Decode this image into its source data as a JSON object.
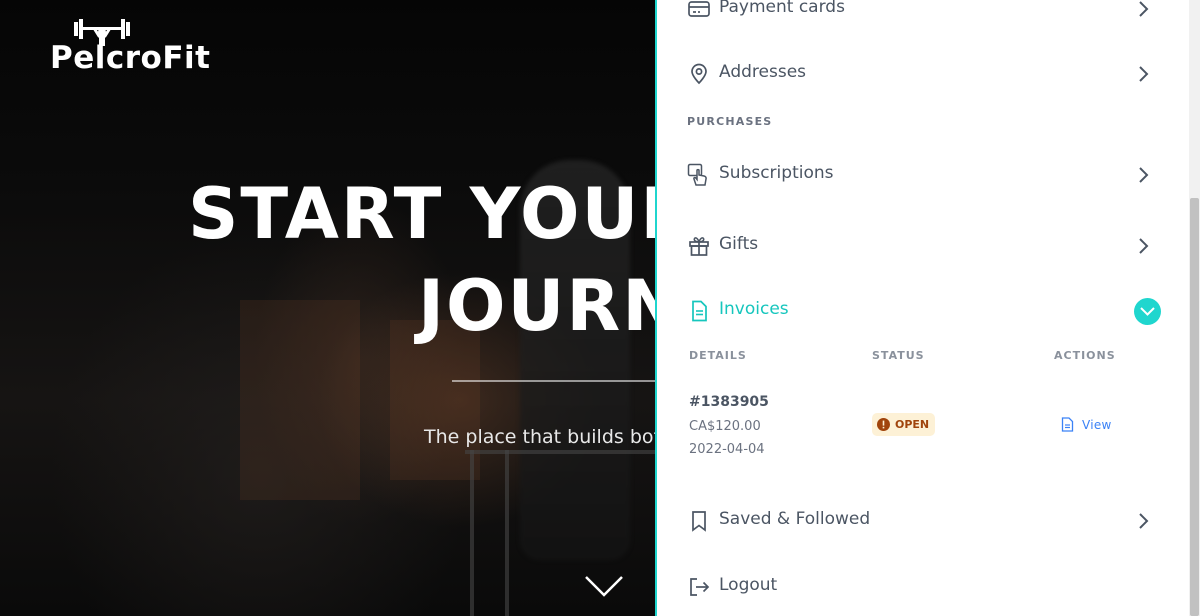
{
  "app": {
    "brand_name": "PelcroFit"
  },
  "hero": {
    "title_line1": "START YOUR",
    "title_line2": "JOURNEY",
    "subtitle": "The place that builds both"
  },
  "account_menu": {
    "payment_cards_label": "Payment cards",
    "addresses_label": "Addresses",
    "purchases_heading": "PURCHASES",
    "subscriptions_label": "Subscriptions",
    "gifts_label": "Gifts",
    "invoices_label": "Invoices",
    "saved_label": "Saved & Followed",
    "logout_label": "Logout"
  },
  "invoices": {
    "columns": {
      "details": "DETAILS",
      "status": "STATUS",
      "actions": "ACTIONS"
    },
    "rows": [
      {
        "number": "#1383905",
        "amount": "CA$120.00",
        "date": "2022-04-04",
        "status": "OPEN",
        "action_label": "View"
      }
    ]
  },
  "colors": {
    "accent": "#1fd6ce",
    "status_open_bg": "#fdf1d6",
    "status_open_text": "#a0440c",
    "link_blue": "#3b82f6"
  },
  "icons": {
    "payment_cards": "credit-card-icon",
    "addresses": "map-pin-icon",
    "subscriptions": "hand-pointer-icon",
    "gifts": "gift-icon",
    "invoices": "document-icon",
    "saved": "bookmark-icon",
    "logout": "logout-icon",
    "row_chevron": "chevron-right-icon",
    "expand_toggle": "chevron-down-icon",
    "status_open": "exclamation-circle-icon",
    "view": "document-icon"
  }
}
